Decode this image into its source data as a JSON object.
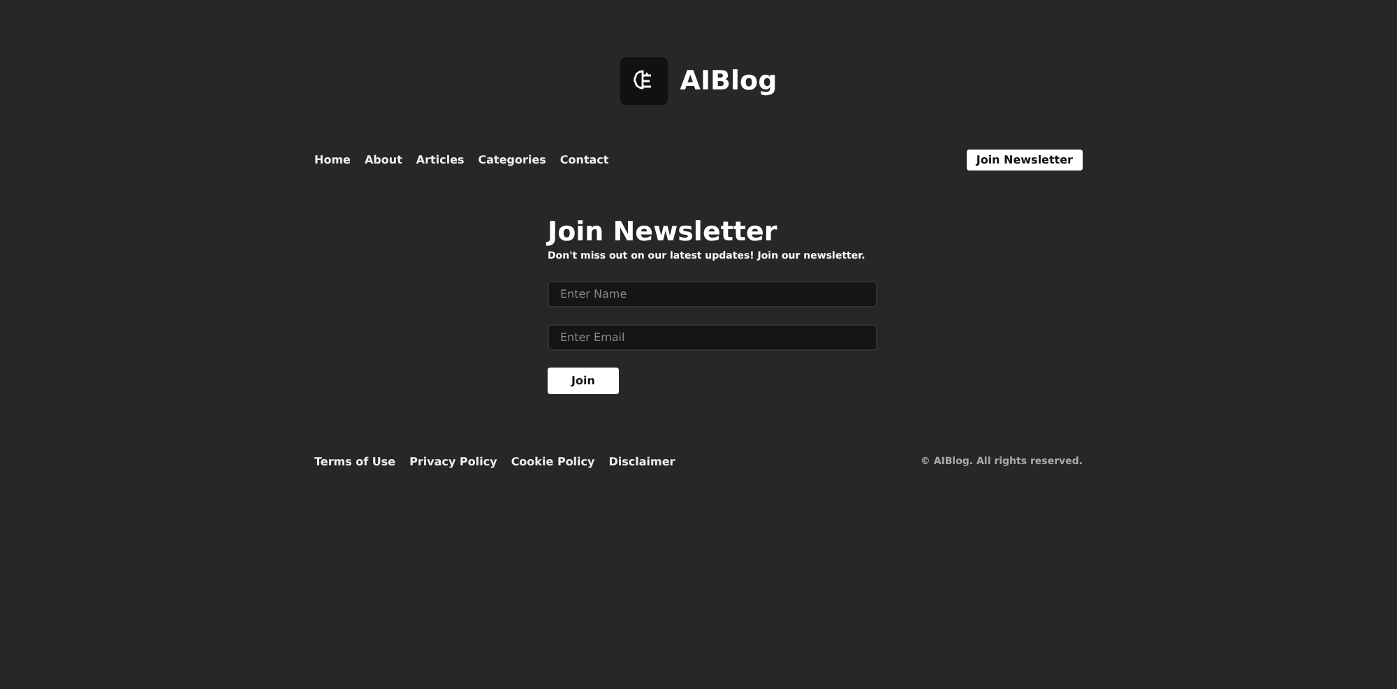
{
  "logo": {
    "text": "AIBlog"
  },
  "nav": {
    "links": [
      "Home",
      "About",
      "Articles",
      "Categories",
      "Contact"
    ],
    "cta": "Join Newsletter"
  },
  "newsletter": {
    "title": "Join Newsletter",
    "subtitle": "Don't miss out on our latest updates! Join our newsletter.",
    "fields": [
      {
        "placeholder": "Enter Name"
      },
      {
        "placeholder": "Enter Email"
      }
    ],
    "button": "Join"
  },
  "footer": {
    "links": [
      "Terms of Use",
      "Privacy Policy",
      "Cookie Policy",
      "Disclaimer"
    ],
    "copyright": "© AIBlog. All rights reserved."
  }
}
